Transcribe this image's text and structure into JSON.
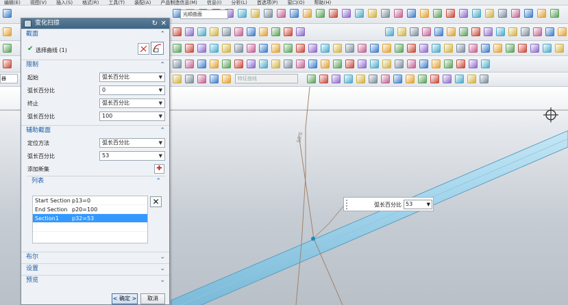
{
  "menu": [
    "编辑(E)",
    "视图(V)",
    "插入(S)",
    "格式(R)",
    "工具(T)",
    "装配(A)",
    "产品制造信息(M)",
    "信息(I)",
    "分析(L)",
    "首选项(P)",
    "窗口(O)",
    "帮助(H)"
  ],
  "toolbar": {
    "search_value": "光顺曲面",
    "filter_placeholder": "特征曲线",
    "left_combo": "器"
  },
  "dialog": {
    "title": "变化扫掠",
    "sections": {
      "section": {
        "title": "截面",
        "select_curve": "选择曲线 (1)"
      },
      "limits": {
        "title": "限制",
        "rows": [
          {
            "label": "起始",
            "value": "弧长百分比"
          },
          {
            "label": "弧长百分比",
            "value": "0"
          },
          {
            "label": "终止",
            "value": "弧长百分比"
          },
          {
            "label": "弧长百分比",
            "value": "100"
          }
        ]
      },
      "aux": {
        "title": "辅助截面",
        "rows": [
          {
            "label": "定位方法",
            "value": "弧长百分比"
          },
          {
            "label": "弧长百分比",
            "value": "53"
          }
        ],
        "add_new": "添加新集",
        "list_title": "列表",
        "list": [
          {
            "name": "Start Section",
            "value": "p13=0"
          },
          {
            "name": "End Section",
            "value": "p20=100"
          },
          {
            "name": "Section1",
            "value": "p32=53"
          }
        ]
      },
      "boolean": {
        "title": "布尔"
      },
      "settings": {
        "title": "设置"
      },
      "preview": {
        "title": "预览"
      }
    },
    "ok_label": "< 确定 >",
    "cancel_label": "取消"
  },
  "float_input": {
    "label": "弧长百分比",
    "value": "53"
  },
  "colors": {
    "title_bar": "#3f6583",
    "accent": "#1f5fa8",
    "selection": "#3399ff",
    "tube": "#a9d8ee"
  }
}
